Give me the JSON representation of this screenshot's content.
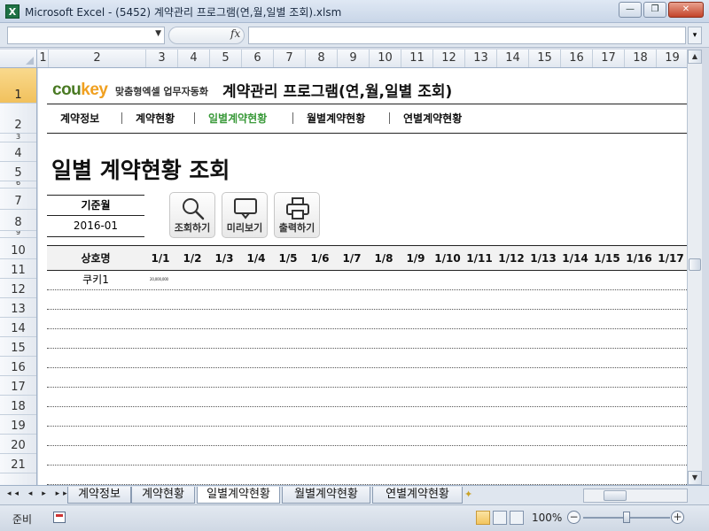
{
  "window": {
    "title": "Microsoft Excel - (5452) 계약관리 프로그램(연,월,일별 조회).xlsm",
    "app_icon": "X",
    "minimize_glyph": "—",
    "restore_glyph": "❐",
    "close_glyph": "✕"
  },
  "formula_bar": {
    "name_box": "",
    "fx": "fx",
    "formula": ""
  },
  "columns": [
    "1",
    "2",
    "3",
    "4",
    "5",
    "6",
    "7",
    "8",
    "9",
    "10",
    "11",
    "12",
    "13",
    "14",
    "15",
    "16",
    "17",
    "18",
    "19"
  ],
  "rows": [
    "1",
    "2",
    "3",
    "4",
    "5",
    "6",
    "7",
    "8",
    "9",
    "10",
    "11",
    "12",
    "13",
    "14",
    "15",
    "16",
    "17",
    "18",
    "19",
    "20",
    "21"
  ],
  "selected_row": "1",
  "header": {
    "logo_main": "cou",
    "logo_accent": "key",
    "logo_sub": "맞춤형엑셀 업무자동화",
    "app_title": "계약관리 프로그램(연,월,일별 조회)"
  },
  "nav": {
    "items": [
      {
        "label": "계약정보",
        "active": false
      },
      {
        "label": "계약현황",
        "active": false
      },
      {
        "label": "일별계약현황",
        "active": true
      },
      {
        "label": "월별계약현황",
        "active": false
      },
      {
        "label": "연별계약현황",
        "active": false
      }
    ]
  },
  "page": {
    "heading": "일별 계약현황 조회",
    "basis_label": "기준월",
    "basis_value": "2016-01"
  },
  "toolbar": {
    "search_label": "조회하기",
    "preview_label": "미리보기",
    "print_label": "출력하기"
  },
  "table": {
    "name_header": "상호명",
    "day_headers": [
      "1/1",
      "1/2",
      "1/3",
      "1/4",
      "1/5",
      "1/6",
      "1/7",
      "1/8",
      "1/9",
      "1/10",
      "1/11",
      "1/12",
      "1/13",
      "1/14",
      "1/15",
      "1/16",
      "1/17"
    ],
    "rows": [
      {
        "name": "쿠키1",
        "amount": "20,000,000"
      },
      {
        "name": "",
        "amount": ""
      },
      {
        "name": "",
        "amount": ""
      },
      {
        "name": "",
        "amount": ""
      },
      {
        "name": "",
        "amount": ""
      },
      {
        "name": "",
        "amount": ""
      },
      {
        "name": "",
        "amount": ""
      },
      {
        "name": "",
        "amount": ""
      },
      {
        "name": "",
        "amount": ""
      },
      {
        "name": "",
        "amount": ""
      },
      {
        "name": "",
        "amount": ""
      }
    ]
  },
  "sheet_tabs": {
    "nav_glyphs": "◂◂ ◂ ▸ ▸▸",
    "tabs": [
      {
        "label": "계약정보",
        "active": false
      },
      {
        "label": "계약현황",
        "active": false
      },
      {
        "label": "일별계약현황",
        "active": true
      },
      {
        "label": "월별계약현황",
        "active": false
      },
      {
        "label": "연별계약현황",
        "active": false
      }
    ]
  },
  "status": {
    "ready": "준비",
    "zoom": "100%",
    "zoom_minus": "−",
    "zoom_plus": "+"
  },
  "colors": {
    "logo_green": "#4a7a23",
    "logo_orange": "#f0a020",
    "nav_active": "#3a9a3a",
    "row_selected": "#f1c15d"
  }
}
